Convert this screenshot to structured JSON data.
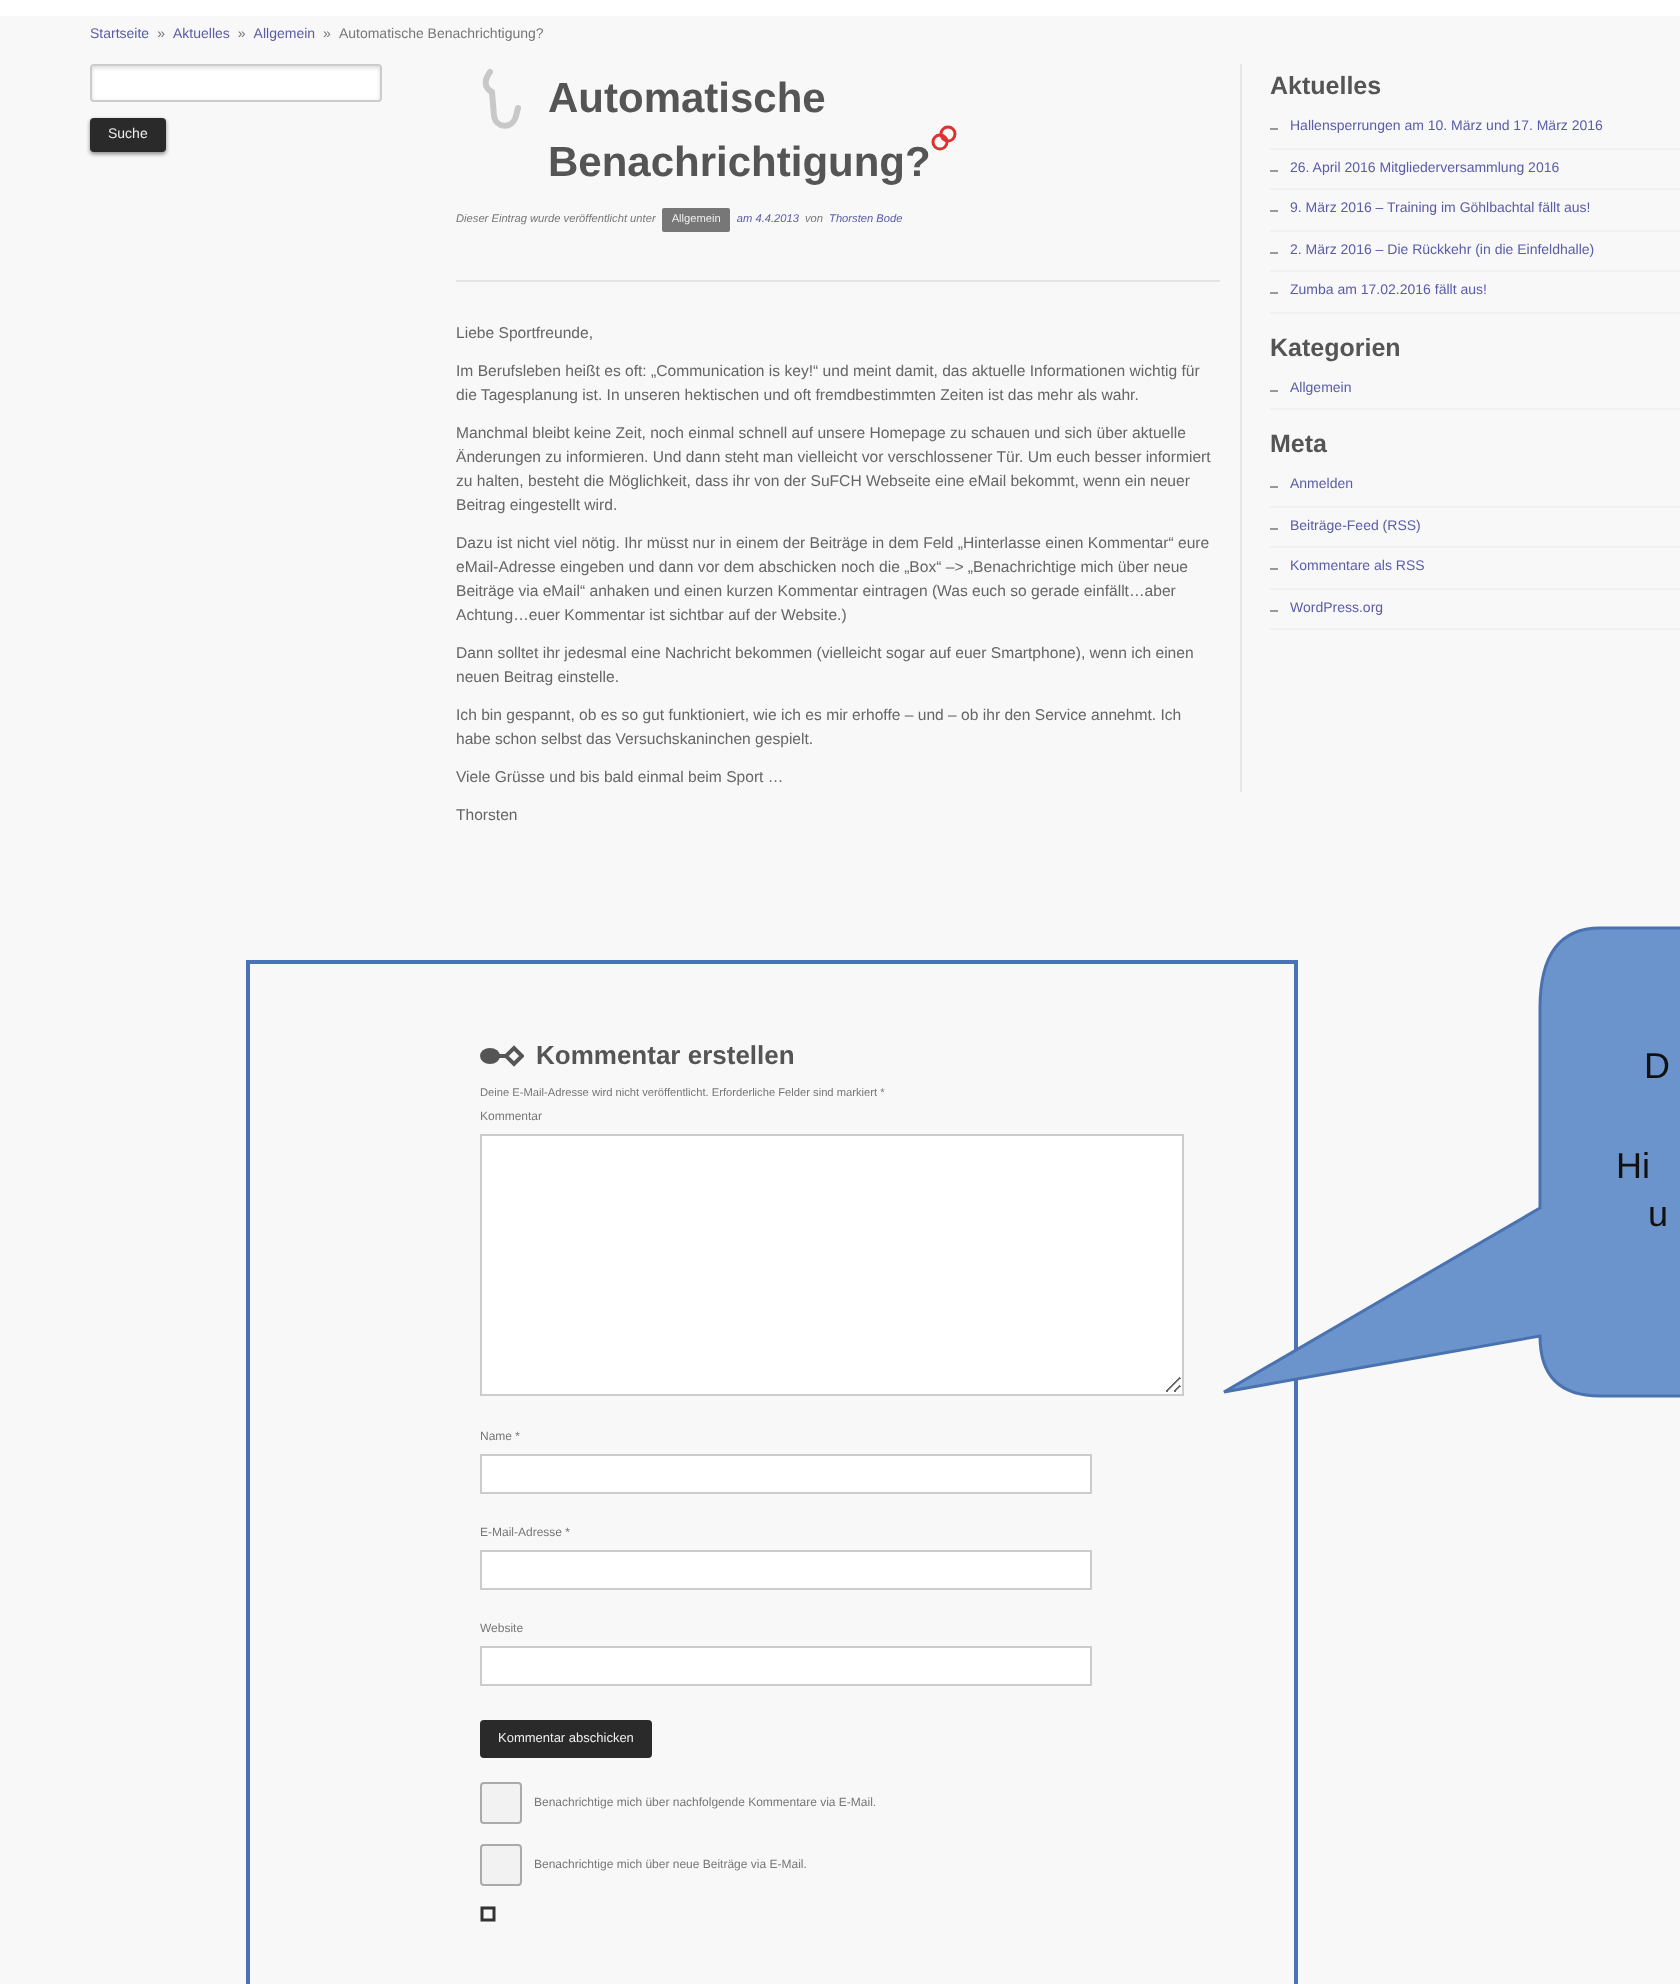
{
  "breadcrumb": [
    {
      "kind": "link",
      "text": "Startseite"
    },
    {
      "kind": "separator",
      "text": "»"
    },
    {
      "kind": "link",
      "text": "Aktuelles"
    },
    {
      "kind": "separator",
      "text": "»"
    },
    {
      "kind": "link",
      "text": "Allgemein"
    },
    {
      "kind": "separator",
      "text": "»"
    },
    {
      "kind": "current",
      "text": "Automatische Benachrichtigung?"
    }
  ],
  "search": {
    "button": "Suche"
  },
  "post": {
    "title": "Automatische Benachrichtigung?",
    "meta": [
      {
        "kind": "text",
        "text": "Dieser Eintrag wurde veröffentlicht unter"
      },
      {
        "kind": "tag",
        "text": "Allgemein"
      },
      {
        "kind": "link",
        "text": "am 4.4.2013"
      },
      {
        "kind": "text",
        "text": "von"
      },
      {
        "kind": "link",
        "text": "Thorsten Bode"
      }
    ],
    "paragraphs": [
      "Liebe Sportfreunde,",
      "Im Berufsleben heißt es oft: „Communication is key!“ und meint damit, das aktuelle Informationen wichtig für die Tagesplanung ist. In unseren hektischen und oft fremdbestimmten Zeiten ist das mehr als wahr.",
      "Manchmal bleibt keine Zeit, noch einmal schnell auf unsere Homepage zu schauen und sich über aktuelle Änderungen zu informieren. Und dann steht man vielleicht vor verschlossener Tür. Um euch besser informiert zu halten, besteht die Möglichkeit, dass ihr von der SuFCH Webseite eine eMail bekommt, wenn ein neuer Beitrag eingestellt wird.",
      "Dazu ist nicht viel nötig. Ihr müsst nur in einem der Beiträge in dem Feld „Hinterlasse einen Kommentar“ eure eMail-Adresse eingeben und dann vor dem abschicken noch die „Box“ –> „Benachrichtige mich über neue Beiträge via eMail“ anhaken und einen kurzen Kommentar eintragen (Was euch so gerade einfällt…aber Achtung…euer Kommentar ist sichtbar auf der Website.)",
      "Dann solltet ihr jedesmal eine Nachricht bekommen (vielleicht sogar auf euer Smartphone), wenn ich einen neuen Beitrag einstelle.",
      "Ich bin gespannt, ob es so gut funktioniert, wie ich es mir erhoffe – und – ob ihr den Service annehmt. Ich habe schon selbst das Versuchskaninchen gespielt.",
      "Viele Grüsse und bis bald einmal beim Sport …",
      "Thorsten"
    ]
  },
  "sidebar": [
    {
      "heading": "Aktuelles",
      "items": [
        "Hallensperrungen am 10. März und 17. März 2016",
        "26. April 2016 Mitgliederversammlung 2016",
        "9. März 2016 – Training im Göhlbachtal fällt aus!",
        "2. März 2016 – Die Rückkehr (in die Einfeldhalle)",
        "Zumba am 17.02.2016 fällt aus!"
      ]
    },
    {
      "heading": "Kategorien",
      "items": [
        "Allgemein"
      ]
    },
    {
      "heading": "Meta",
      "items": [
        "Anmelden",
        "Beiträge-Feed (RSS)",
        "Kommentare als RSS",
        "WordPress.org"
      ]
    }
  ],
  "comment_form": {
    "title": "Kommentar erstellen",
    "note": "Deine E-Mail-Adresse wird nicht veröffentlicht. Erforderliche Felder sind markiert *",
    "comment_label": "Kommentar",
    "fields": [
      {
        "label": "Name *"
      },
      {
        "label": "E-Mail-Adresse *"
      },
      {
        "label": "Website"
      }
    ],
    "submit": "Kommentar abschicken",
    "options": [
      {
        "label": "Benachrichtige mich über nachfolgende Kommentare via E-Mail.",
        "checked": false
      },
      {
        "label": "Benachrichtige mich über neue Beiträge via E-Mail.",
        "checked": false
      }
    ]
  },
  "callout": {
    "lines": [
      "D",
      "Hi",
      "u"
    ]
  }
}
